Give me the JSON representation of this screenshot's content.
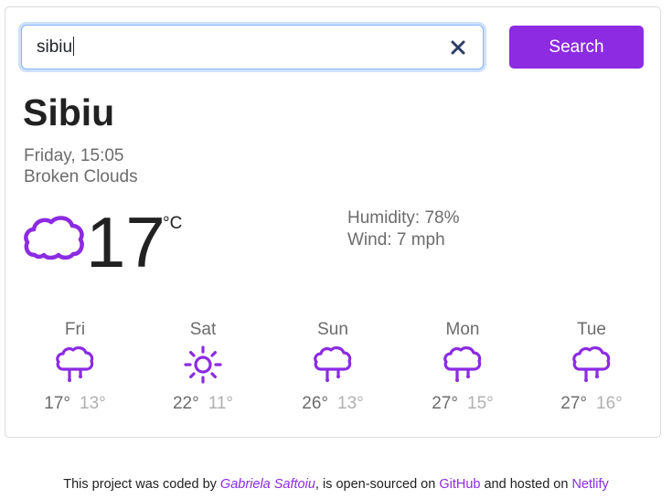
{
  "search": {
    "value": "sibiu",
    "button_label": "Search"
  },
  "current": {
    "city": "Sibiu",
    "datetime": "Friday, 15:05",
    "condition": "Broken Clouds",
    "icon": "cloud-icon",
    "temperature": "17",
    "unit": "°C",
    "humidity": "Humidity: 78%",
    "wind": "Wind: 7 mph"
  },
  "forecast": [
    {
      "day": "Fri",
      "icon": "rain-cloud-icon",
      "max": "17°",
      "min": "13°"
    },
    {
      "day": "Sat",
      "icon": "sun-icon",
      "max": "22°",
      "min": "11°"
    },
    {
      "day": "Sun",
      "icon": "rain-cloud-icon",
      "max": "26°",
      "min": "13°"
    },
    {
      "day": "Mon",
      "icon": "rain-cloud-icon",
      "max": "27°",
      "min": "15°"
    },
    {
      "day": "Tue",
      "icon": "rain-cloud-icon",
      "max": "27°",
      "min": "16°"
    }
  ],
  "footer": {
    "part1": "This project was coded by ",
    "author": "Gabriela Saftoiu",
    "part2": ", is open-sourced on ",
    "github": "GitHub",
    "part3": " and hosted on ",
    "netlify": "Netlify"
  },
  "colors": {
    "accent": "#8c2be2",
    "text_muted": "#6c6c6c"
  }
}
